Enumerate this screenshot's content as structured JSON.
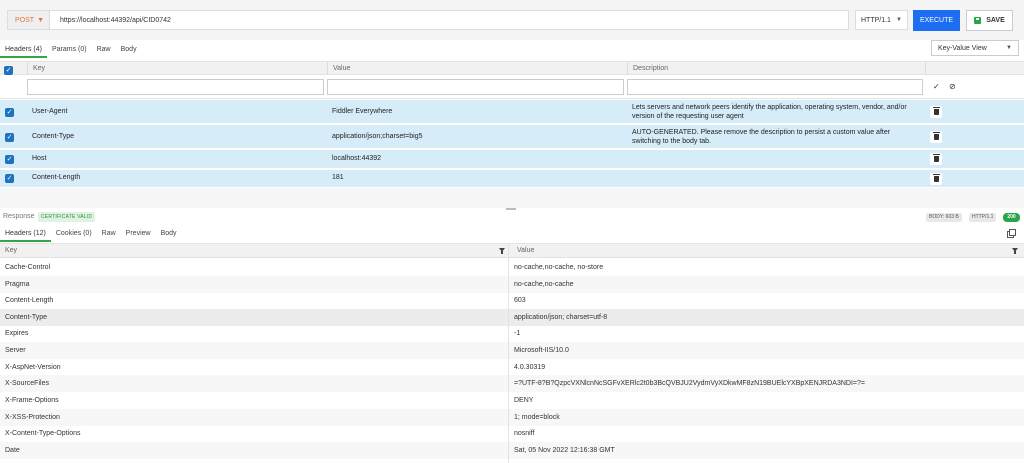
{
  "request": {
    "method": "POST",
    "url": "https://localhost:44392/api/CID0742",
    "http_version": "HTTP/1.1",
    "execute_label": "EXECUTE",
    "save_label": "SAVE"
  },
  "request_tabs": [
    {
      "label": "Headers (4)",
      "active": true
    },
    {
      "label": "Params (0)",
      "active": false
    },
    {
      "label": "Raw",
      "active": false
    },
    {
      "label": "Body",
      "active": false
    }
  ],
  "view_mode": "Key-Value View",
  "request_grid": {
    "columns": [
      "Key",
      "Value",
      "Description"
    ],
    "rows": [
      {
        "key": "User-Agent",
        "value": "Fiddler Everywhere",
        "description": "Lets servers and network peers identify the application, operating system, vendor, and/or version of the requesting user agent"
      },
      {
        "key": "Content-Type",
        "value": "application/json;charset=big5",
        "description": "AUTO-GENERATED. Please remove the description to persist a custom value after switching to the body tab."
      },
      {
        "key": "Host",
        "value": "localhost:44392",
        "description": ""
      },
      {
        "key": "Content-Length",
        "value": "181",
        "description": ""
      }
    ]
  },
  "response": {
    "label": "Response",
    "certificate": "CERTIFICATE VALID",
    "body_size": "BODY: 603 B",
    "http_version": "HTTP/1.1",
    "status_code": "200"
  },
  "response_tabs": [
    {
      "label": "Headers (12)",
      "active": true
    },
    {
      "label": "Cookies (0)",
      "active": false
    },
    {
      "label": "Raw",
      "active": false
    },
    {
      "label": "Preview",
      "active": false
    },
    {
      "label": "Body",
      "active": false
    }
  ],
  "response_grid": {
    "columns": [
      "Key",
      "Value"
    ],
    "rows": [
      {
        "key": "Cache-Control",
        "value": "no-cache,no-cache, no-store"
      },
      {
        "key": "Pragma",
        "value": "no-cache,no-cache"
      },
      {
        "key": "Content-Length",
        "value": "603"
      },
      {
        "key": "Content-Type",
        "value": "application/json; charset=utf-8"
      },
      {
        "key": "Expires",
        "value": "-1"
      },
      {
        "key": "Server",
        "value": "Microsoft-IIS/10.0"
      },
      {
        "key": "X-AspNet-Version",
        "value": "4.0.30319"
      },
      {
        "key": "X-SourceFiles",
        "value": "=?UTF-8?B?QzpcVXNlcnNcSGFvXERlc2t0b3BcQVBJU2VydmVyXDkwMF8zN19BUElcYXBpXENJRDA3NDI=?="
      },
      {
        "key": "X-Frame-Options",
        "value": "DENY"
      },
      {
        "key": "X-XSS-Protection",
        "value": "1; mode=block"
      },
      {
        "key": "X-Content-Type-Options",
        "value": "nosniff"
      },
      {
        "key": "Date",
        "value": "Sat, 05 Nov 2022 12:16:38 GMT"
      }
    ]
  }
}
